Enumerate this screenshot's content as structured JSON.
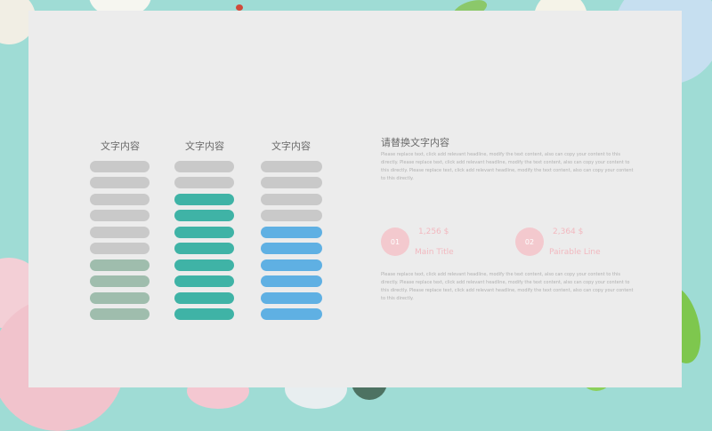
{
  "columns": [
    {
      "title": "文字内容",
      "bar_colors": [
        "#c9c9c9",
        "#c9c9c9",
        "#c9c9c9",
        "#c9c9c9",
        "#c9c9c9",
        "#c9c9c9",
        "#9fbdad",
        "#9fbdad",
        "#9fbdad",
        "#9fbdad"
      ]
    },
    {
      "title": "文字内容",
      "bar_colors": [
        "#c9c9c9",
        "#c9c9c9",
        "#3fb3a6",
        "#3fb3a6",
        "#3fb3a6",
        "#3fb3a6",
        "#3fb3a6",
        "#3fb3a6",
        "#3fb3a6",
        "#3fb3a6"
      ]
    },
    {
      "title": "文字内容",
      "bar_colors": [
        "#c9c9c9",
        "#c9c9c9",
        "#c9c9c9",
        "#c9c9c9",
        "#5fb0e3",
        "#5fb0e3",
        "#5fb0e3",
        "#5fb0e3",
        "#5fb0e3",
        "#5fb0e3"
      ]
    }
  ],
  "right": {
    "title": "请替换文字内容",
    "paragraph1": "Please replace text, click add relevant headline, modify the text content, also can copy your content to this directly. Please replace text, click add relevant headline, modify the text content, also can copy your content to this directly. Please replace text, click add relevant headline, modify the text content, also can copy your content to this directly.",
    "items": [
      {
        "badge": "01",
        "heading": "1,256 $",
        "subtitle": "Main Title"
      },
      {
        "badge": "02",
        "heading": "2,364 $",
        "subtitle": "Pairable Line"
      }
    ],
    "paragraph2": "Please replace text, click add relevant headline, modify the text content, also can copy your content to this directly. Please replace text, click add relevant headline, modify the text content, also can copy your content to this directly. Please replace text, click add relevant headline, modify the text content, also can copy your content to this directly."
  },
  "colors": {
    "frame_teal": "#9fdcd5",
    "panel": "#ececec",
    "gray_bar": "#c9c9c9",
    "sage_bar": "#9fbdad",
    "teal_bar": "#3fb3a6",
    "blue_bar": "#5fb0e3",
    "pink_accent": "#f2b8bf"
  }
}
